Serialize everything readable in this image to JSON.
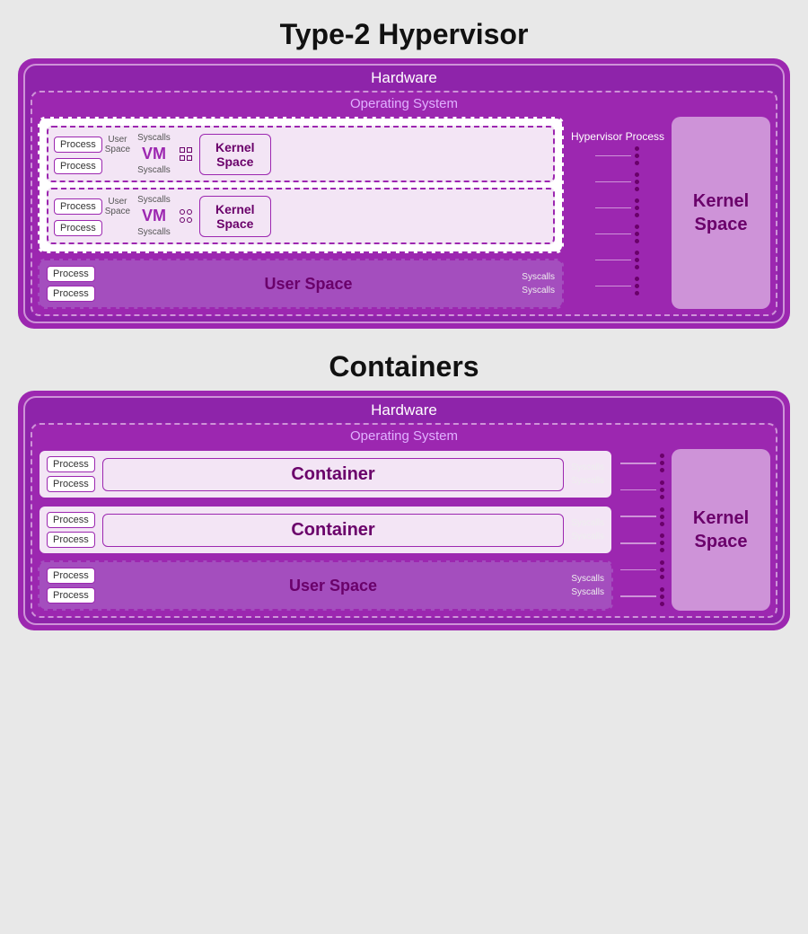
{
  "hypervisor": {
    "title": "Type-2 Hypervisor",
    "hardware_label": "Hardware",
    "os_label": "Operating System",
    "vm1": {
      "process1": "Process",
      "process2": "Process",
      "user_space": "User",
      "space": "Space",
      "syscalls1": "Syscalls",
      "syscalls2": "Syscalls",
      "vm_label": "VM",
      "kernel_space": "Kernel\nSpace"
    },
    "vm2": {
      "process1": "Process",
      "process2": "Process",
      "user_space": "User",
      "space": "Space",
      "syscalls1": "Syscalls",
      "syscalls2": "Syscalls",
      "vm_label": "VM",
      "kernel_space": "Kernel\nSpace"
    },
    "hypervisor_process": "Hypervisor\nProcess",
    "user_space_label": "User Space",
    "process3": "Process",
    "process4": "Process",
    "syscalls3": "Syscalls",
    "syscalls4": "Syscalls",
    "kernel_space_right": "Kernel\nSpace"
  },
  "containers": {
    "title": "Containers",
    "hardware_label": "Hardware",
    "os_label": "Operating System",
    "container1": {
      "process1": "Process",
      "process2": "Process",
      "label": "Container",
      "syscalls1": "Syscalls",
      "syscalls2": "Syscalls"
    },
    "container2": {
      "process1": "Process",
      "process2": "Process",
      "label": "Container",
      "syscalls1": "Syscalls",
      "syscalls2": "Syscalls"
    },
    "user_space": {
      "process1": "Process",
      "process2": "Process",
      "label": "User Space",
      "syscalls1": "Syscalls",
      "syscalls2": "Syscalls"
    },
    "kernel_space_right": "Kernel\nSpace"
  }
}
